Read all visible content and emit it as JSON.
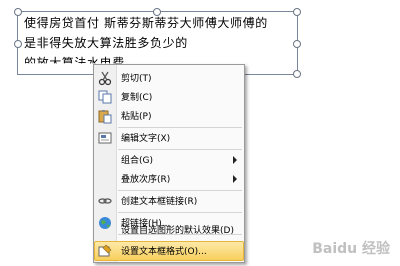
{
  "textbox": {
    "lines": [
      "使得房贷首付    斯蒂芬斯蒂芬大师傅大师傅的",
      "是非得失放大算法胜多负少的",
      "的放大算法水电费"
    ]
  },
  "menu": {
    "items": [
      {
        "label": "剪切(T)",
        "icon": "scissors-icon"
      },
      {
        "label": "复制(C)",
        "icon": "copy-icon"
      },
      {
        "label": "粘贴(P)",
        "icon": "paste-icon"
      },
      {
        "label": "编辑文字(X)",
        "icon": "edit-text-icon"
      },
      {
        "label": "组合(G)",
        "icon": ""
      },
      {
        "label": "叠放次序(R)",
        "icon": ""
      },
      {
        "label": "创建文本框链接(R)",
        "icon": "link-icon"
      },
      {
        "label": "超链接(H)...",
        "icon": "hyperlink-globe-icon"
      },
      {
        "label": "设置自选图形的默认效果(D)",
        "icon": ""
      },
      {
        "label": "设置文本框格式(O)...",
        "icon": "format-textbox-icon"
      }
    ],
    "highlight_color": "#f8cf5d"
  },
  "watermark": "Baidu 经验"
}
